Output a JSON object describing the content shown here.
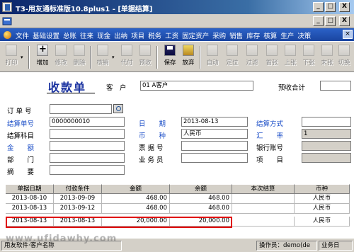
{
  "window": {
    "title": "T3-用友通标准版10.8plus1 - [单据结算]",
    "minimize": "_",
    "restore": "□",
    "close": "X"
  },
  "menubar": {
    "items": [
      "文件",
      "基础设置",
      "总账",
      "往来",
      "现金",
      "出纳",
      "项目",
      "税务",
      "工资",
      "固定资产",
      "采购",
      "销售",
      "库存",
      "核算",
      "生产",
      "决策"
    ],
    "close": "×"
  },
  "toolbar": {
    "buttons": [
      {
        "label": "打印",
        "enabled": false
      },
      {
        "label": "增加",
        "enabled": true
      },
      {
        "label": "修改",
        "enabled": false
      },
      {
        "label": "删除",
        "enabled": false
      },
      {
        "label": "核销",
        "enabled": false
      },
      {
        "label": "代付",
        "enabled": false
      },
      {
        "label": "预收",
        "enabled": false
      },
      {
        "label": "保存",
        "enabled": true
      },
      {
        "label": "放弃",
        "enabled": true
      },
      {
        "label": "自动",
        "enabled": false
      },
      {
        "label": "定位",
        "enabled": false
      },
      {
        "label": "过滤",
        "enabled": false
      },
      {
        "label": "首张",
        "enabled": false
      },
      {
        "label": "上张",
        "enabled": false
      },
      {
        "label": "下张",
        "enabled": false
      },
      {
        "label": "末张",
        "enabled": false
      },
      {
        "label": "切换",
        "enabled": false
      }
    ]
  },
  "doc": {
    "title": "收款单",
    "customer_label": "客　户",
    "customer_value": "01  A客户",
    "prepay_label": "预收合计"
  },
  "form": {
    "order_no_label": "订 单 号",
    "settle_no_label": "结算单号",
    "settle_no_value": "0000000010",
    "settle_subject_label": "结算科目",
    "amount_label": "金　　额",
    "dept_label": "部　　门",
    "summary_label": "摘　　要",
    "date_label": "日　　期",
    "date_value": "2013-08-13",
    "currency_label": "币　　种",
    "currency_value": "人民币",
    "bill_no_label": "票 据 号",
    "clerk_label": "业 务 员",
    "settle_method_label": "结算方式",
    "rate_label": "汇　　率",
    "rate_value": "1",
    "bank_label": "银行账号",
    "project_label": "项　　目"
  },
  "grid": {
    "headers": [
      "单据日期",
      "付款条件",
      "金额",
      "余额",
      "本次结算",
      "币种"
    ],
    "rows": [
      {
        "date": "2013-08-10",
        "term": "2013-09-09",
        "amount": "468.00",
        "balance": "468.00",
        "settle": "",
        "currency": "人民币"
      },
      {
        "date": "2013-08-13",
        "term": "2013-09-12",
        "amount": "468.00",
        "balance": "468.00",
        "settle": "",
        "currency": "人民币"
      },
      {
        "date": "2013-08-13",
        "term": "2013-08-13",
        "amount": "20,000.00",
        "balance": "20,000.00",
        "settle": "",
        "currency": "人民币"
      }
    ]
  },
  "status": {
    "left": "用友软件·客户名称",
    "operator_label": "操作员：",
    "operator_value": "demo(de",
    "business_date": "业务日"
  },
  "watermark": "www.ufidawhy.com",
  "colors": {
    "title_bar": "#0a246a",
    "menubar": "#2c62c8",
    "doc_title": "#1a32a0",
    "highlight_border": "#e00000"
  }
}
